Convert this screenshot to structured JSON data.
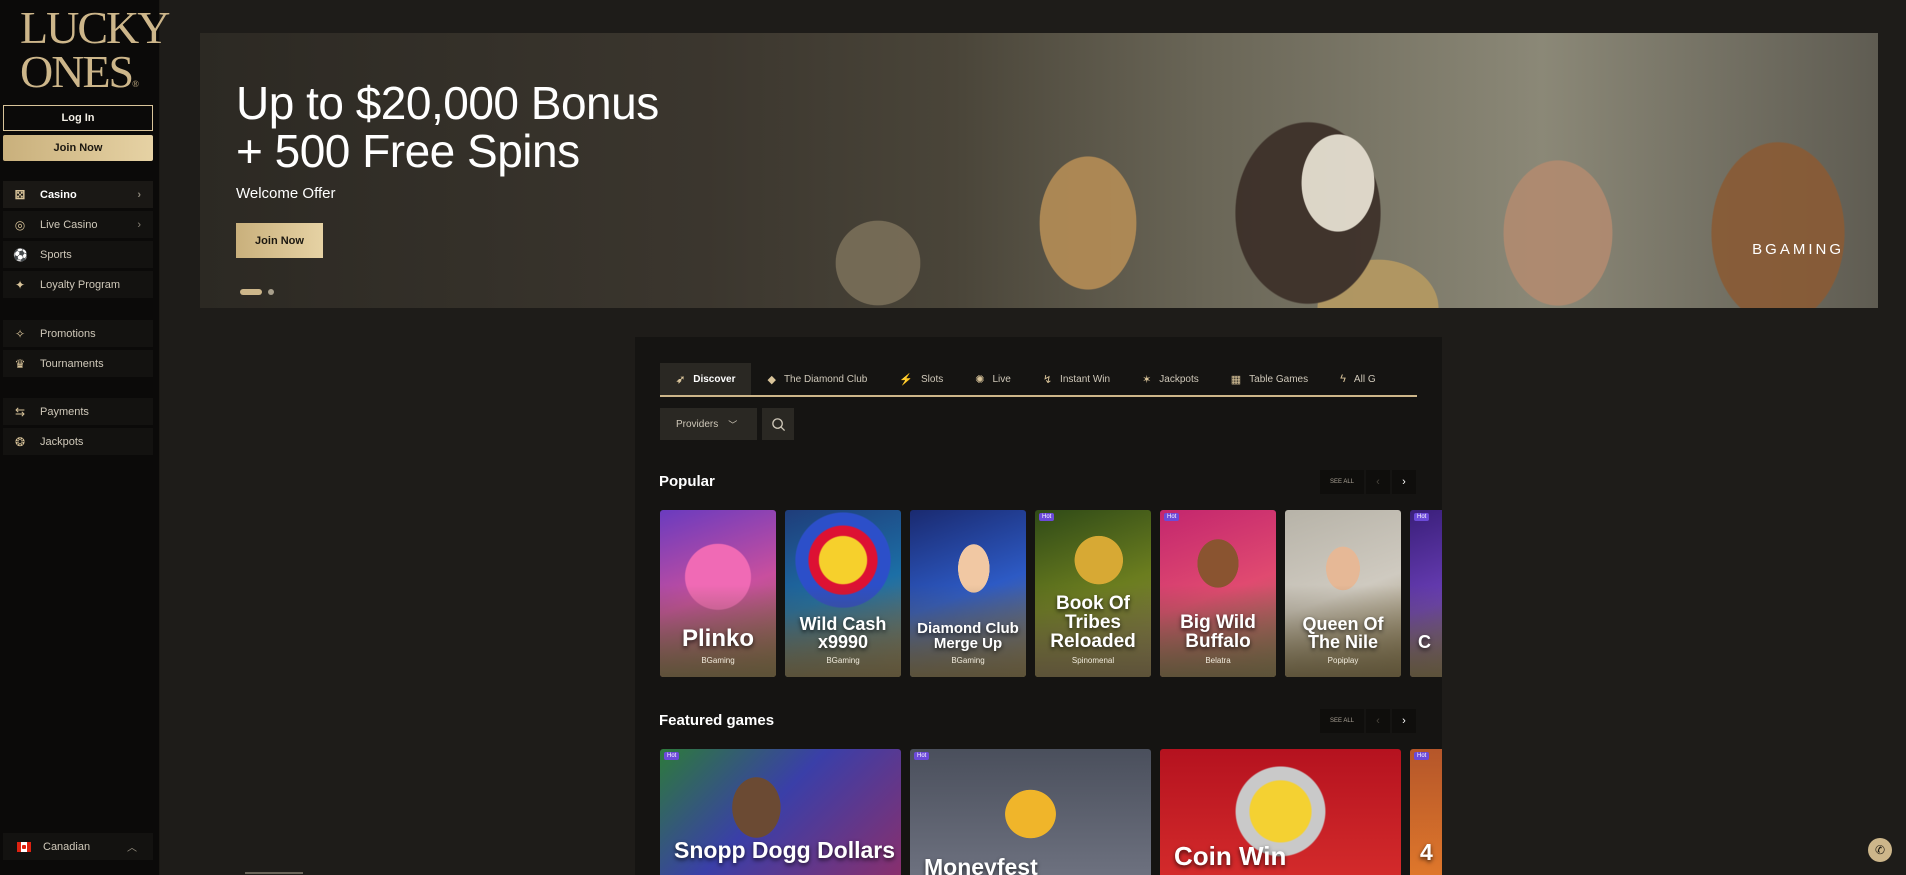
{
  "brand": {
    "logo_line1": "LUCKY",
    "logo_line2": "ONES",
    "logo_mark": "®"
  },
  "auth": {
    "login_label": "Log In",
    "join_label": "Join Now"
  },
  "sidebar": {
    "items": [
      {
        "label": "Casino",
        "icon": "dice-icon",
        "chevron": true
      },
      {
        "label": "Live Casino",
        "icon": "roulette-icon",
        "chevron": true
      },
      {
        "label": "Sports",
        "icon": "ball-icon"
      },
      {
        "label": "Loyalty Program",
        "icon": "sparkle-icon"
      },
      {
        "label": "Promotions",
        "icon": "party-icon"
      },
      {
        "label": "Tournaments",
        "icon": "trophy-icon"
      },
      {
        "label": "Payments",
        "icon": "exchange-icon"
      },
      {
        "label": "Jackpots",
        "icon": "jackpot-icon"
      }
    ],
    "locale": "Canadian"
  },
  "banner": {
    "headline_line1": "Up to $20,000 Bonus",
    "headline_line2": "+ 500 Free Spins",
    "subtitle": "Welcome Offer",
    "cta": "Join Now",
    "brand_mark": "BGAMING"
  },
  "tabs": [
    {
      "label": "Discover",
      "icon": "rocket-icon"
    },
    {
      "label": "The Diamond Club",
      "icon": "diamond-icon"
    },
    {
      "label": "Slots",
      "icon": "slots-icon"
    },
    {
      "label": "Live",
      "icon": "live-icon"
    },
    {
      "label": "Instant Win",
      "icon": "instant-icon"
    },
    {
      "label": "Jackpots",
      "icon": "sparkles-icon"
    },
    {
      "label": "Table Games",
      "icon": "cards-icon"
    },
    {
      "label": "All G",
      "icon": "bolt-icon"
    }
  ],
  "filters": {
    "providers_label": "Providers"
  },
  "popular": {
    "title": "Popular",
    "see_all": "SEE ALL",
    "games": [
      {
        "name": "Plinko",
        "provider": "BGaming",
        "hot": false
      },
      {
        "name": "Wild Cash x9990",
        "provider": "BGaming",
        "hot": false
      },
      {
        "name": "Diamond Club Merge Up",
        "provider": "BGaming",
        "hot": false
      },
      {
        "name": "Book Of Tribes Reloaded",
        "provider": "Spinomenal",
        "hot": true
      },
      {
        "name": "Big Wild Buffalo",
        "provider": "Belatra",
        "hot": true
      },
      {
        "name": "Queen Of The Nile",
        "provider": "Popiplay",
        "hot": false
      },
      {
        "name": "C",
        "provider": "",
        "hot": true
      }
    ]
  },
  "featured": {
    "title": "Featured games",
    "see_all": "SEE ALL",
    "games": [
      {
        "name": "Snopp Dogg Dollars",
        "hot": true
      },
      {
        "name": "Moneyfest",
        "hot": true
      },
      {
        "name": "Coin Win",
        "hot": false
      },
      {
        "name": "4",
        "hot": true
      }
    ]
  },
  "hot_label": "Hot",
  "colors": {
    "accent": "#cdb68a",
    "background": "#1e1c19",
    "hot_badge": "#6c4ad9"
  }
}
